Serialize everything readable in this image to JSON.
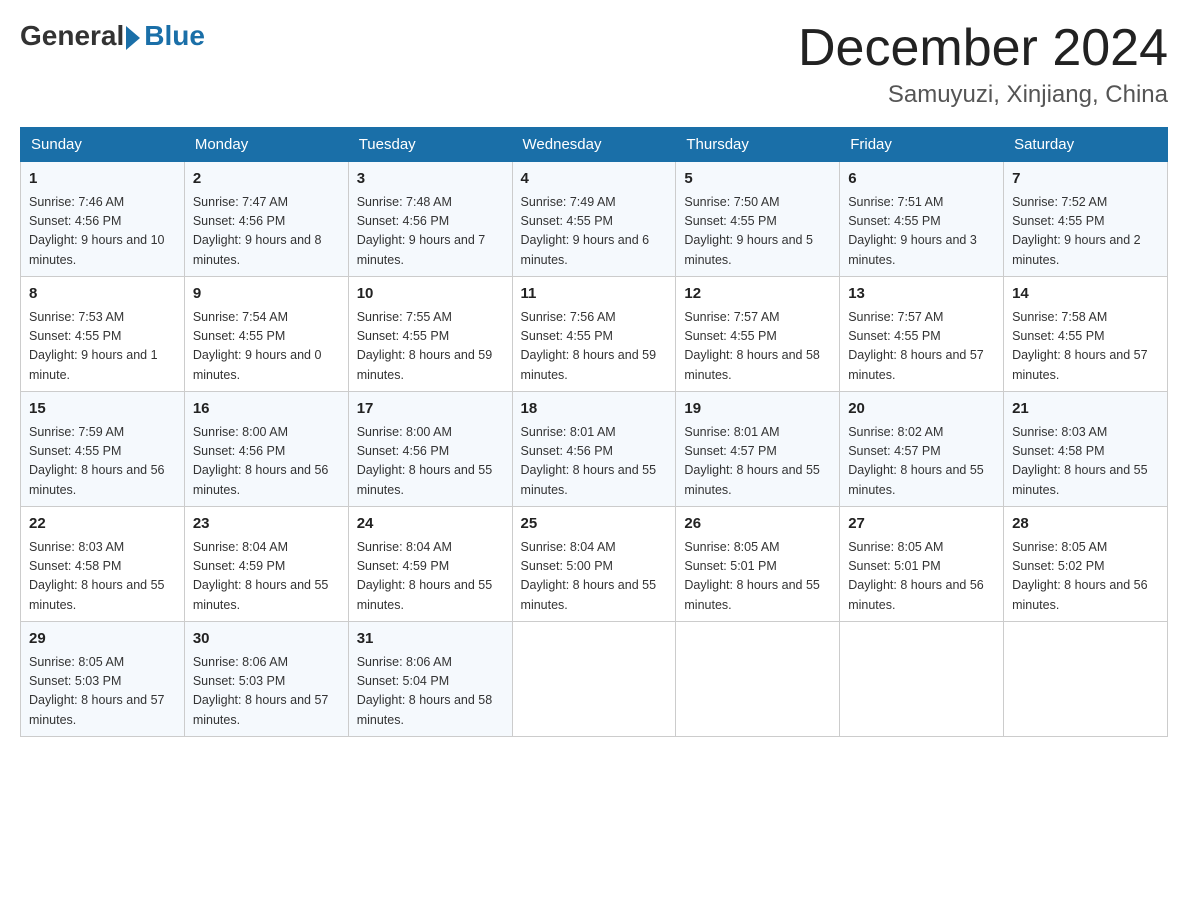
{
  "logo": {
    "general": "General",
    "blue": "Blue"
  },
  "title": "December 2024",
  "location": "Samuyuzi, Xinjiang, China",
  "days_of_week": [
    "Sunday",
    "Monday",
    "Tuesday",
    "Wednesday",
    "Thursday",
    "Friday",
    "Saturday"
  ],
  "weeks": [
    [
      {
        "day": "1",
        "sunrise": "7:46 AM",
        "sunset": "4:56 PM",
        "daylight": "9 hours and 10 minutes."
      },
      {
        "day": "2",
        "sunrise": "7:47 AM",
        "sunset": "4:56 PM",
        "daylight": "9 hours and 8 minutes."
      },
      {
        "day": "3",
        "sunrise": "7:48 AM",
        "sunset": "4:56 PM",
        "daylight": "9 hours and 7 minutes."
      },
      {
        "day": "4",
        "sunrise": "7:49 AM",
        "sunset": "4:55 PM",
        "daylight": "9 hours and 6 minutes."
      },
      {
        "day": "5",
        "sunrise": "7:50 AM",
        "sunset": "4:55 PM",
        "daylight": "9 hours and 5 minutes."
      },
      {
        "day": "6",
        "sunrise": "7:51 AM",
        "sunset": "4:55 PM",
        "daylight": "9 hours and 3 minutes."
      },
      {
        "day": "7",
        "sunrise": "7:52 AM",
        "sunset": "4:55 PM",
        "daylight": "9 hours and 2 minutes."
      }
    ],
    [
      {
        "day": "8",
        "sunrise": "7:53 AM",
        "sunset": "4:55 PM",
        "daylight": "9 hours and 1 minute."
      },
      {
        "day": "9",
        "sunrise": "7:54 AM",
        "sunset": "4:55 PM",
        "daylight": "9 hours and 0 minutes."
      },
      {
        "day": "10",
        "sunrise": "7:55 AM",
        "sunset": "4:55 PM",
        "daylight": "8 hours and 59 minutes."
      },
      {
        "day": "11",
        "sunrise": "7:56 AM",
        "sunset": "4:55 PM",
        "daylight": "8 hours and 59 minutes."
      },
      {
        "day": "12",
        "sunrise": "7:57 AM",
        "sunset": "4:55 PM",
        "daylight": "8 hours and 58 minutes."
      },
      {
        "day": "13",
        "sunrise": "7:57 AM",
        "sunset": "4:55 PM",
        "daylight": "8 hours and 57 minutes."
      },
      {
        "day": "14",
        "sunrise": "7:58 AM",
        "sunset": "4:55 PM",
        "daylight": "8 hours and 57 minutes."
      }
    ],
    [
      {
        "day": "15",
        "sunrise": "7:59 AM",
        "sunset": "4:55 PM",
        "daylight": "8 hours and 56 minutes."
      },
      {
        "day": "16",
        "sunrise": "8:00 AM",
        "sunset": "4:56 PM",
        "daylight": "8 hours and 56 minutes."
      },
      {
        "day": "17",
        "sunrise": "8:00 AM",
        "sunset": "4:56 PM",
        "daylight": "8 hours and 55 minutes."
      },
      {
        "day": "18",
        "sunrise": "8:01 AM",
        "sunset": "4:56 PM",
        "daylight": "8 hours and 55 minutes."
      },
      {
        "day": "19",
        "sunrise": "8:01 AM",
        "sunset": "4:57 PM",
        "daylight": "8 hours and 55 minutes."
      },
      {
        "day": "20",
        "sunrise": "8:02 AM",
        "sunset": "4:57 PM",
        "daylight": "8 hours and 55 minutes."
      },
      {
        "day": "21",
        "sunrise": "8:03 AM",
        "sunset": "4:58 PM",
        "daylight": "8 hours and 55 minutes."
      }
    ],
    [
      {
        "day": "22",
        "sunrise": "8:03 AM",
        "sunset": "4:58 PM",
        "daylight": "8 hours and 55 minutes."
      },
      {
        "day": "23",
        "sunrise": "8:04 AM",
        "sunset": "4:59 PM",
        "daylight": "8 hours and 55 minutes."
      },
      {
        "day": "24",
        "sunrise": "8:04 AM",
        "sunset": "4:59 PM",
        "daylight": "8 hours and 55 minutes."
      },
      {
        "day": "25",
        "sunrise": "8:04 AM",
        "sunset": "5:00 PM",
        "daylight": "8 hours and 55 minutes."
      },
      {
        "day": "26",
        "sunrise": "8:05 AM",
        "sunset": "5:01 PM",
        "daylight": "8 hours and 55 minutes."
      },
      {
        "day": "27",
        "sunrise": "8:05 AM",
        "sunset": "5:01 PM",
        "daylight": "8 hours and 56 minutes."
      },
      {
        "day": "28",
        "sunrise": "8:05 AM",
        "sunset": "5:02 PM",
        "daylight": "8 hours and 56 minutes."
      }
    ],
    [
      {
        "day": "29",
        "sunrise": "8:05 AM",
        "sunset": "5:03 PM",
        "daylight": "8 hours and 57 minutes."
      },
      {
        "day": "30",
        "sunrise": "8:06 AM",
        "sunset": "5:03 PM",
        "daylight": "8 hours and 57 minutes."
      },
      {
        "day": "31",
        "sunrise": "8:06 AM",
        "sunset": "5:04 PM",
        "daylight": "8 hours and 58 minutes."
      },
      null,
      null,
      null,
      null
    ]
  ],
  "labels": {
    "sunrise_prefix": "Sunrise: ",
    "sunset_prefix": "Sunset: ",
    "daylight_prefix": "Daylight: "
  }
}
